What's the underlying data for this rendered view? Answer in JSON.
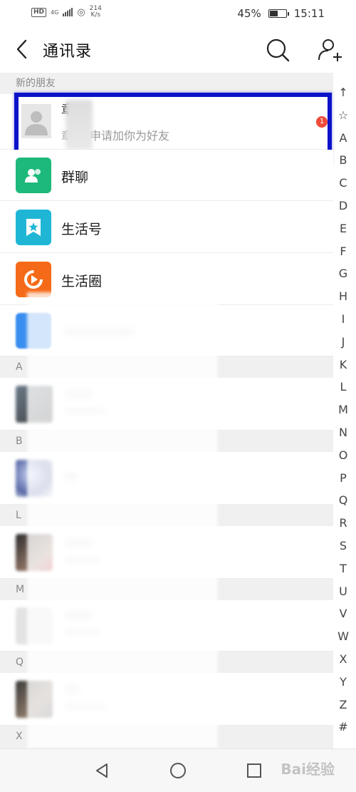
{
  "status_bar": {
    "network": "HD",
    "signal_label": "4G",
    "speed_value": "214",
    "speed_unit": "K/s",
    "battery_percent": "45%",
    "time": "15:11"
  },
  "header": {
    "title": "通讯录"
  },
  "new_friends": {
    "section_label": "新的朋友",
    "name_visible": "章",
    "subtitle_prefix": "章",
    "subtitle": "申请加你为好友",
    "badge_count": "1"
  },
  "fixed_items": [
    {
      "label": "群聊",
      "color": "#1db97a"
    },
    {
      "label": "生活号",
      "color": "#1fb6d6"
    },
    {
      "label": "生活圈",
      "color": "#f56a18"
    }
  ],
  "sections": [
    "A",
    "B",
    "L",
    "M",
    "Q",
    "X"
  ],
  "alphabet_index": [
    "↑",
    "☆",
    "A",
    "B",
    "C",
    "D",
    "E",
    "F",
    "G",
    "H",
    "I",
    "J",
    "K",
    "L",
    "M",
    "N",
    "O",
    "P",
    "Q",
    "R",
    "S",
    "T",
    "U",
    "V",
    "W",
    "X",
    "Y",
    "Z",
    "#"
  ],
  "watermark": "Bai经验",
  "colors": {
    "highlight_border": "#0b12c8",
    "badge": "#f04b3a",
    "section_bg": "#f0f0f0"
  }
}
